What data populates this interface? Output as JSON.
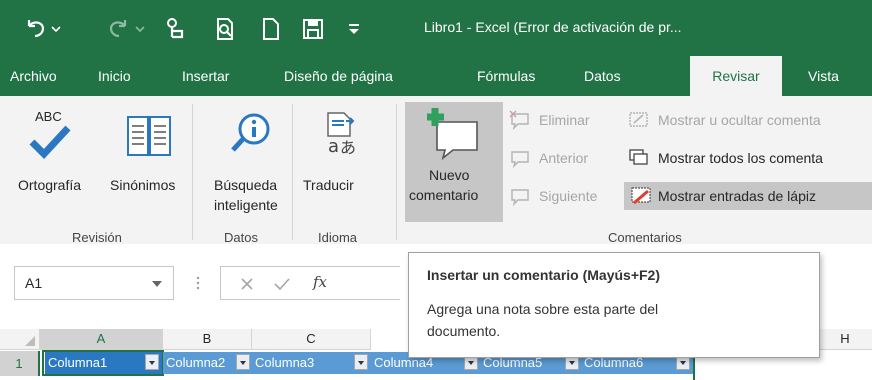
{
  "window": {
    "title": "Libro1 - Excel (Error de activación de pr..."
  },
  "tabs": [
    "Archivo",
    "Inicio",
    "Insertar",
    "Diseño de página",
    "Fórmulas",
    "Datos",
    "Revisar",
    "Vista"
  ],
  "active_tab": "Revisar",
  "ribbon": {
    "spelling": {
      "abc": "ABC",
      "label": "Ortografía"
    },
    "thesaurus": {
      "label": "Sinónimos"
    },
    "smart_lookup": {
      "line1": "Búsqueda",
      "line2": "inteligente"
    },
    "translate": {
      "label": "Traducir"
    },
    "new_comment": {
      "line1": "Nuevo",
      "line2": "comentario"
    },
    "delete": "Eliminar",
    "previous": "Anterior",
    "next": "Siguiente",
    "show_hide": "Mostrar u ocultar comenta",
    "show_all": "Mostrar todos los comenta",
    "show_ink": "Mostrar entradas de lápiz",
    "groups": {
      "revision": "Revisión",
      "datos": "Datos",
      "idioma": "Idioma",
      "comentarios": "Comentarios"
    }
  },
  "formula_bar": {
    "name_box": "A1",
    "fx": "fx"
  },
  "tooltip": {
    "title": "Insertar un comentario (Mayús+F2)",
    "line1": "Agrega una nota sobre esta parte del",
    "line2": "documento."
  },
  "grid": {
    "col_headers": [
      "A",
      "B",
      "C",
      "H"
    ],
    "row1": "1",
    "table_headers": [
      "Columna1",
      "Columna2",
      "Columna3",
      "Columna4",
      "Columna5",
      "Columna6"
    ]
  },
  "colors": {
    "excel_green": "#217346",
    "table_header_blue": "#5b9bd5",
    "accent_blue": "#2b78c2"
  }
}
